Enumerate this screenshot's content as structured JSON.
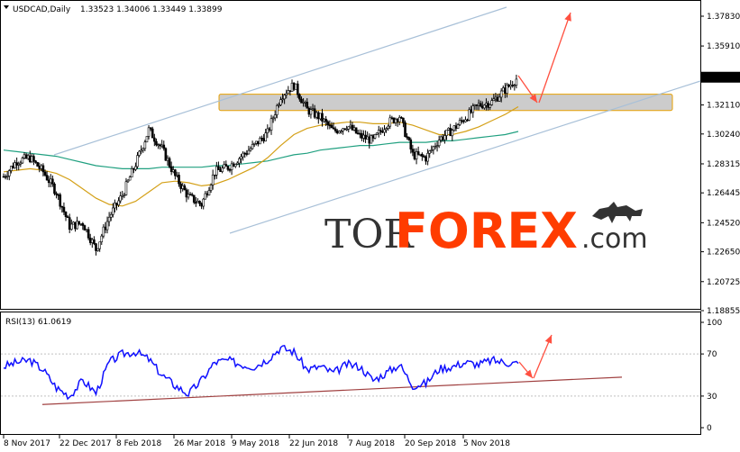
{
  "header": {
    "symbol_label": "USDCAD,Daily",
    "ohlc": "1.33523 1.34006 1.33449 1.33899"
  },
  "rsi_panel": {
    "label": "RSI(13) 61.0619"
  },
  "watermark": {
    "part1": "TOR",
    "part2": "FOREX",
    "part3": ".com",
    "logo_icon": "bull-bear-icon"
  },
  "colors": {
    "bull_candle": "#000000",
    "bear_candle": "#000000",
    "ma_fast": "#d4a017",
    "ma_slow": "#20a080",
    "channel": "#a8c0d8",
    "zone_fill": "#cccccc",
    "zone_border": "#e8a000",
    "arrow": "#ff5040",
    "rsi_line": "#1010ff",
    "rsi_trend": "#a04040",
    "watermark_accent": "#ff3c00"
  },
  "chart_data": [
    {
      "type": "candlestick",
      "title": "USDCAD,Daily",
      "current_price_label": "1.33899",
      "y_ticks": [
        "1.37830",
        "1.35910",
        "1.33899",
        "1.32110",
        "1.30240",
        "1.28315",
        "1.26445",
        "1.24520",
        "1.22650",
        "1.20725",
        "1.18855"
      ],
      "ylim": [
        1.18855,
        1.3783
      ],
      "x_ticks": [
        "8 Nov 2017",
        "22 Dec 2017",
        "8 Feb 2018",
        "26 Mar 2018",
        "9 May 2018",
        "22 Jun 2018",
        "7 Aug 2018",
        "20 Sep 2018",
        "5 Nov 2018"
      ],
      "price_path": {
        "x": [
          "8 Nov 2017",
          "20 Nov 2017",
          "30 Nov 2017",
          "15 Dec 2017",
          "22 Dec 2017",
          "5 Jan 2018",
          "18 Jan 2018",
          "25 Jan 2018",
          "8 Feb 2018",
          "20 Feb 2018",
          "1 Mar 2018",
          "12 Mar 2018",
          "20 Mar 2018",
          "26 Mar 2018",
          "5 Apr 2018",
          "16 Apr 2018",
          "25 Apr 2018",
          "9 May 2018",
          "18 May 2018",
          "29 May 2018",
          "12 Jun 2018",
          "22 Jun 2018",
          "27 Jun 2018",
          "5 Jul 2018",
          "16 Jul 2018",
          "24 Jul 2018",
          "7 Aug 2018",
          "15 Aug 2018",
          "22 Aug 2018",
          "30 Aug 2018",
          "10 Sep 2018",
          "20 Sep 2018",
          "1 Oct 2018",
          "12 Oct 2018",
          "24 Oct 2018",
          "5 Nov 2018",
          "14 Nov 2018",
          "21 Nov 2018",
          "28 Nov 2018",
          "4 Dec 2018"
        ],
        "values": [
          1.275,
          1.285,
          1.287,
          1.278,
          1.265,
          1.243,
          1.245,
          1.228,
          1.249,
          1.263,
          1.283,
          1.305,
          1.293,
          1.275,
          1.262,
          1.257,
          1.278,
          1.281,
          1.288,
          1.295,
          1.303,
          1.327,
          1.334,
          1.318,
          1.313,
          1.304,
          1.308,
          1.301,
          1.298,
          1.309,
          1.314,
          1.289,
          1.287,
          1.299,
          1.305,
          1.313,
          1.321,
          1.323,
          1.331,
          1.339
        ]
      },
      "ma_fast": [
        1.278,
        1.279,
        1.28,
        1.279,
        1.277,
        1.273,
        1.267,
        1.261,
        1.257,
        1.256,
        1.259,
        1.265,
        1.271,
        1.272,
        1.271,
        1.269,
        1.27,
        1.273,
        1.277,
        1.281,
        1.287,
        1.295,
        1.302,
        1.306,
        1.308,
        1.309,
        1.31,
        1.31,
        1.309,
        1.309,
        1.31,
        1.308,
        1.305,
        1.302,
        1.302,
        1.304,
        1.307,
        1.311,
        1.315,
        1.32
      ],
      "ma_slow": [
        1.292,
        1.291,
        1.29,
        1.289,
        1.288,
        1.286,
        1.284,
        1.282,
        1.281,
        1.28,
        1.28,
        1.28,
        1.281,
        1.281,
        1.281,
        1.281,
        1.282,
        1.282,
        1.283,
        1.284,
        1.285,
        1.287,
        1.289,
        1.29,
        1.292,
        1.293,
        1.294,
        1.295,
        1.295,
        1.296,
        1.297,
        1.297,
        1.297,
        1.298,
        1.298,
        1.299,
        1.3,
        1.301,
        1.302,
        1.304
      ],
      "resistance_zone": [
        1.3175,
        1.328
      ],
      "annotations": [
        "upward channel",
        "resistance zone",
        "pullback-then-rally arrows"
      ]
    },
    {
      "type": "line",
      "title": "RSI(13) 61.0619",
      "y_ticks": [
        "100",
        "70",
        "30",
        "0"
      ],
      "ylim": [
        0,
        100
      ],
      "x": [
        "8 Nov 2017",
        "20 Nov 2017",
        "30 Nov 2017",
        "15 Dec 2017",
        "22 Dec 2017",
        "5 Jan 2018",
        "18 Jan 2018",
        "25 Jan 2018",
        "8 Feb 2018",
        "20 Feb 2018",
        "1 Mar 2018",
        "12 Mar 2018",
        "20 Mar 2018",
        "26 Mar 2018",
        "5 Apr 2018",
        "16 Apr 2018",
        "25 Apr 2018",
        "9 May 2018",
        "18 May 2018",
        "29 May 2018",
        "12 Jun 2018",
        "22 Jun 2018",
        "27 Jun 2018",
        "5 Jul 2018",
        "16 Jul 2018",
        "24 Jul 2018",
        "7 Aug 2018",
        "15 Aug 2018",
        "22 Aug 2018",
        "30 Aug 2018",
        "10 Sep 2018",
        "20 Sep 2018",
        "1 Oct 2018",
        "12 Oct 2018",
        "24 Oct 2018",
        "5 Nov 2018",
        "14 Nov 2018",
        "21 Nov 2018",
        "28 Nov 2018",
        "4 Dec 2018"
      ],
      "values": [
        58,
        62,
        64,
        55,
        38,
        30,
        45,
        33,
        62,
        70,
        72,
        65,
        50,
        40,
        32,
        45,
        62,
        64,
        60,
        58,
        65,
        76,
        72,
        55,
        58,
        52,
        60,
        58,
        45,
        52,
        60,
        40,
        42,
        56,
        58,
        62,
        60,
        64,
        62,
        61
      ],
      "trendline": [
        22,
        48
      ]
    }
  ]
}
